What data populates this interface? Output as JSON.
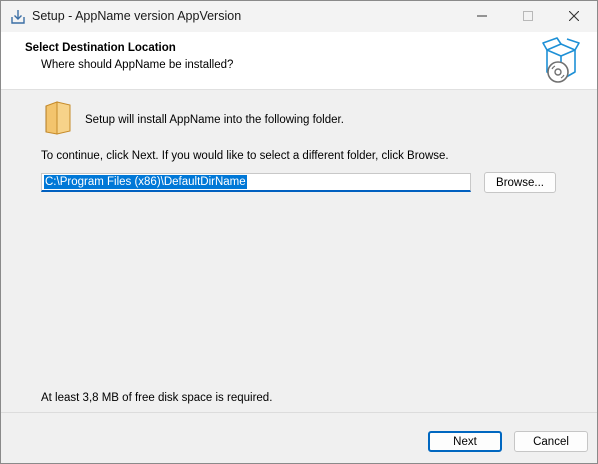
{
  "window": {
    "title": "Setup - AppName version AppVersion",
    "minimize_icon": "minimize-icon",
    "maximize_icon": "maximize-icon",
    "close_icon": "close-icon"
  },
  "header": {
    "title": "Select Destination Location",
    "subtitle": "Where should AppName be installed?",
    "icon": "install-box-icon"
  },
  "body": {
    "folder_icon": "folder-icon",
    "install_text": "Setup will install AppName into the following folder.",
    "continue_text": "To continue, click Next. If you would like to select a different folder, click Browse.",
    "path_value": "C:\\Program Files (x86)\\DefaultDirName",
    "browse_label": "Browse...",
    "disk_space_text": "At least 3,8 MB of free disk space is required."
  },
  "footer": {
    "next_label": "Next",
    "cancel_label": "Cancel"
  },
  "colors": {
    "accent": "#0067c0",
    "selection": "#0078d7",
    "body_bg": "#f0f0f0",
    "folder": "#f3c46d"
  }
}
